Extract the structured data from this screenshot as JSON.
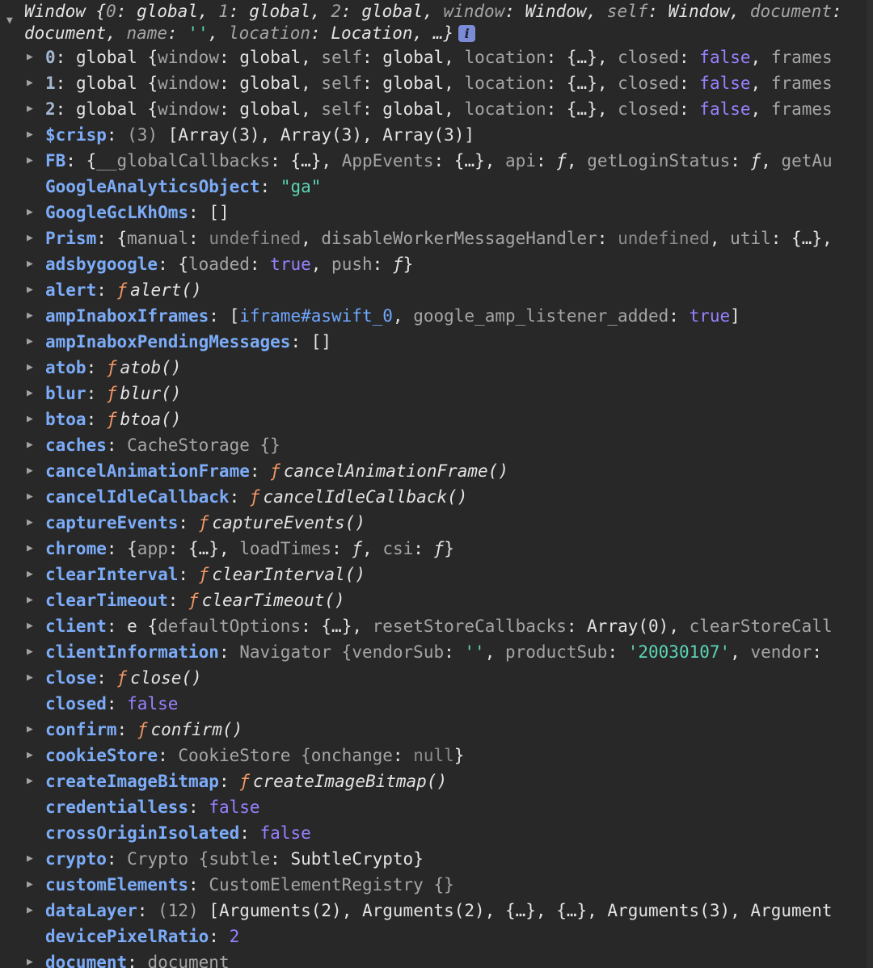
{
  "header": {
    "window_class": "Window",
    "k0": "0",
    "v0": "global",
    "k1": "1",
    "v1": "global",
    "k2": "2",
    "v2": "global",
    "kwindow": "window",
    "vwindow": "Window",
    "kself": "self",
    "vself": "Window",
    "kdocument": "document",
    "vdocument": "document",
    "kname": "name",
    "vname": "''",
    "klocation": "location",
    "vlocation": "Location",
    "ellipsis": "…",
    "info_icon": "i"
  },
  "icons": {
    "expand": "▶",
    "collapse": "▼",
    "function": "ƒ"
  },
  "rows": [
    {
      "key": "0",
      "v1": "global {",
      "k2": "window",
      "v2": "global",
      "k3": "self",
      "v3": "global",
      "k4": "location",
      "v4": "{…}",
      "k5": "closed",
      "v5": "false",
      "k6": "frames"
    },
    {
      "key": "1",
      "v1": "global {",
      "k2": "window",
      "v2": "global",
      "k3": "self",
      "v3": "global",
      "k4": "location",
      "v4": "{…}",
      "k5": "closed",
      "v5": "false",
      "k6": "frames"
    },
    {
      "key": "2",
      "v1": "global {",
      "k2": "window",
      "v2": "global",
      "k3": "self",
      "v3": "global",
      "k4": "location",
      "v4": "{…}",
      "k5": "closed",
      "v5": "false",
      "k6": "frames"
    },
    {
      "key": "$crisp",
      "count": "(3)",
      "value": "[Array(3), Array(3), Array(3)]"
    },
    {
      "key": "FB",
      "k1": "__globalCallbacks",
      "v1": "{…}",
      "k2": "AppEvents",
      "v2": "{…}",
      "k3": "api",
      "k4": "getLoginStatus",
      "k5": "getAu"
    },
    {
      "key": "GoogleAnalyticsObject",
      "value": "\"ga\""
    },
    {
      "key": "GoogleGcLKhOms",
      "value": "[]"
    },
    {
      "key": "Prism",
      "k1": "manual",
      "v1": "undefined",
      "k2": "disableWorkerMessageHandler",
      "v2": "undefined",
      "k3": "util",
      "v3": "{…},"
    },
    {
      "key": "adsbygoogle",
      "k1": "loaded",
      "v1": "true",
      "k2": "push"
    },
    {
      "key": "alert",
      "fn": "alert()"
    },
    {
      "key": "ampInaboxIframes",
      "v1": "iframe#aswift_0",
      "k2": "google_amp_listener_added",
      "v2": "true"
    },
    {
      "key": "ampInaboxPendingMessages",
      "value": "[]"
    },
    {
      "key": "atob",
      "fn": "atob()"
    },
    {
      "key": "blur",
      "fn": "blur()"
    },
    {
      "key": "btoa",
      "fn": "btoa()"
    },
    {
      "key": "caches",
      "value": "CacheStorage {}"
    },
    {
      "key": "cancelAnimationFrame",
      "fn": "cancelAnimationFrame()"
    },
    {
      "key": "cancelIdleCallback",
      "fn": "cancelIdleCallback()"
    },
    {
      "key": "captureEvents",
      "fn": "captureEvents()"
    },
    {
      "key": "chrome",
      "k1": "app",
      "v1": "{…}",
      "k2": "loadTimes",
      "k3": "csi"
    },
    {
      "key": "clearInterval",
      "fn": "clearInterval()"
    },
    {
      "key": "clearTimeout",
      "fn": "clearTimeout()"
    },
    {
      "key": "client",
      "cls": "e {",
      "k1": "defaultOptions",
      "v1": "{…}",
      "k2": "resetStoreCallbacks",
      "v2": "Array(0)",
      "k3": "clearStoreCall"
    },
    {
      "key": "clientInformation",
      "cls": "Navigator {",
      "k1": "vendorSub",
      "v1": "''",
      "k2": "productSub",
      "v2": "'20030107'",
      "k3": "vendor"
    },
    {
      "key": "close",
      "fn": "close()"
    },
    {
      "key": "closed",
      "value": "false"
    },
    {
      "key": "confirm",
      "fn": "confirm()"
    },
    {
      "key": "cookieStore",
      "cls": "CookieStore {",
      "k1": "onchange",
      "v1": "null"
    },
    {
      "key": "createImageBitmap",
      "fn": "createImageBitmap()"
    },
    {
      "key": "credentialless",
      "value": "false"
    },
    {
      "key": "crossOriginIsolated",
      "value": "false"
    },
    {
      "key": "crypto",
      "cls": "Crypto {",
      "k1": "subtle",
      "v1": "SubtleCrypto"
    },
    {
      "key": "customElements",
      "value": "CustomElementRegistry {}"
    },
    {
      "key": "dataLayer",
      "count": "(12)",
      "value": "[Arguments(2), Arguments(2), {…}, {…}, Arguments(3), Argument"
    },
    {
      "key": "devicePixelRatio",
      "value": "2"
    },
    {
      "key": "document",
      "value": "document"
    }
  ]
}
